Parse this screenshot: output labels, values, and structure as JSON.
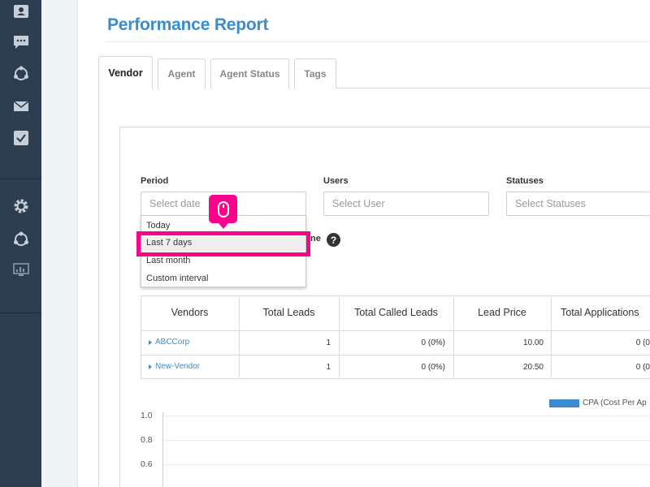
{
  "sidebar": {
    "top_icons": [
      "contacts-icon",
      "chat-icon",
      "network-icon",
      "mail-icon",
      "task-icon"
    ],
    "bottom_icons": [
      "settings-icon",
      "network-icon",
      "monitor-icon"
    ]
  },
  "page": {
    "title": "Performance Report"
  },
  "tabs": [
    {
      "label": "Vendor",
      "active": true
    },
    {
      "label": "Agent",
      "active": false
    },
    {
      "label": "Agent Status",
      "active": false
    },
    {
      "label": "Tags",
      "active": false
    }
  ],
  "filters": {
    "period": {
      "label": "Period",
      "placeholder": "Select date"
    },
    "users": {
      "label": "Users",
      "placeholder": "Select User"
    },
    "statuses": {
      "label": "Statuses",
      "placeholder": "Select Statuses"
    },
    "hidden_label_fragment": "ne"
  },
  "period_options": [
    {
      "label": "Today",
      "highlighted": false
    },
    {
      "label": "Last 7 days",
      "highlighted": true
    },
    {
      "label": "Last month",
      "highlighted": false
    },
    {
      "label": "Custom interval",
      "highlighted": false
    }
  ],
  "table": {
    "headers": [
      "Vendors",
      "Total Leads",
      "Total Called Leads",
      "Lead Price",
      "Total Applications"
    ],
    "rows": [
      {
        "vendor": "ABCCorp",
        "total_leads": "1",
        "called_leads": "0 (0%)",
        "lead_price": "10.00",
        "applications": "0 (0"
      },
      {
        "vendor": "New-Vendor",
        "total_leads": "1",
        "called_leads": "0 (0%)",
        "lead_price": "20.50",
        "applications": "0 (0"
      }
    ]
  },
  "chart": {
    "legend": "CPA (Cost Per Ap",
    "y_ticks": [
      "1.0",
      "0.8",
      "0.6"
    ]
  },
  "colors": {
    "accent": "#3a8ccf",
    "highlight": "#ff008c",
    "sidebar": "#2d3e50"
  }
}
